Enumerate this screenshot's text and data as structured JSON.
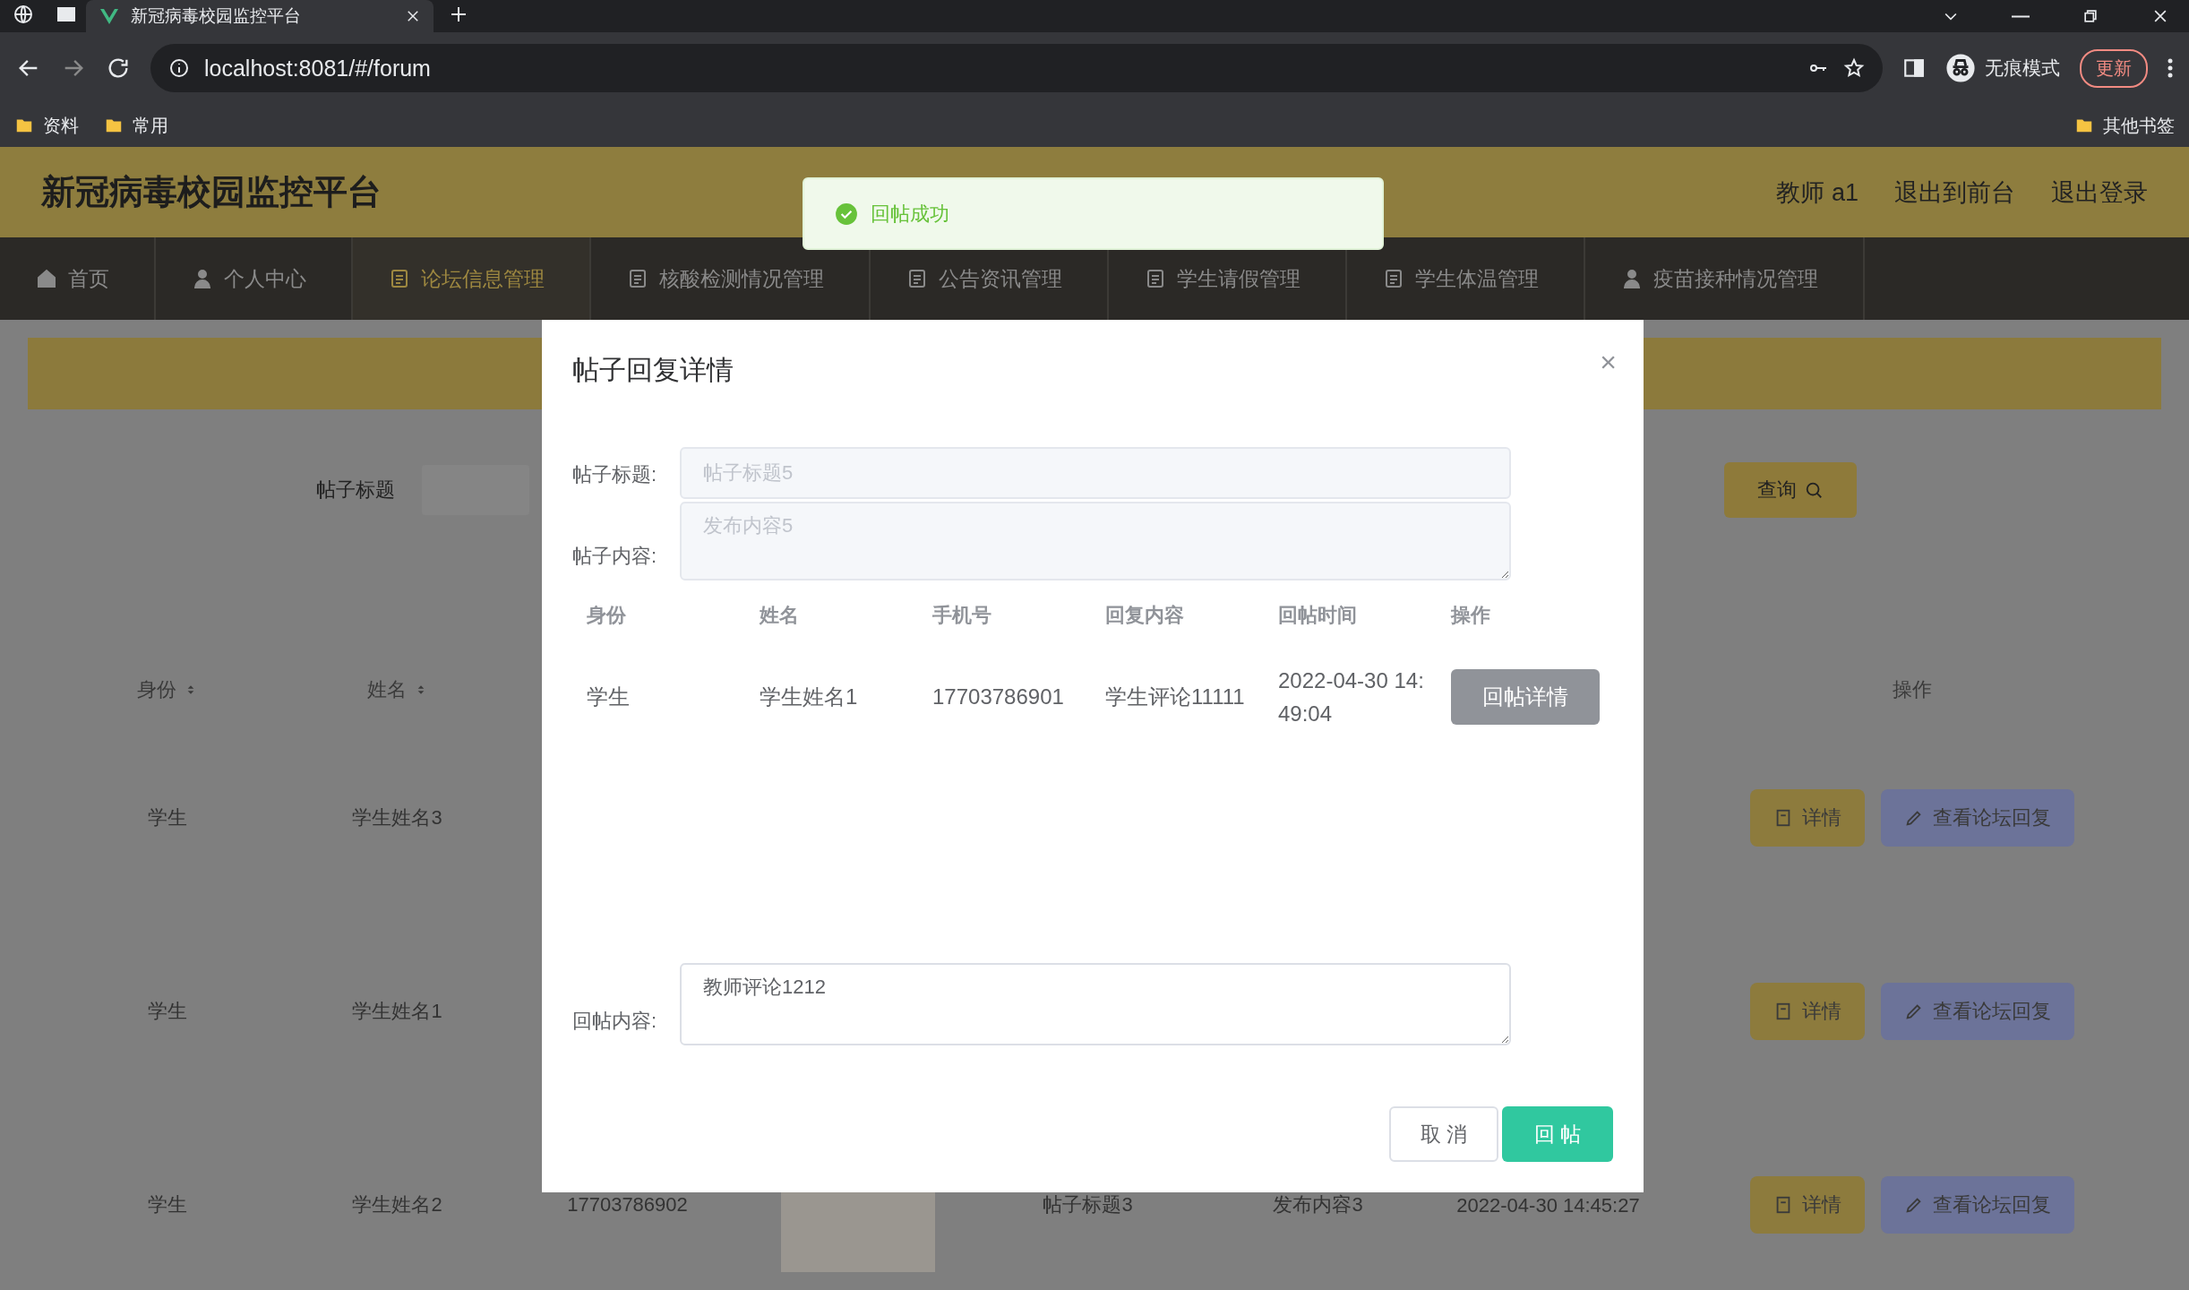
{
  "browser": {
    "tab_title": "新冠病毒校园监控平台",
    "address": "localhost:8081/#/forum",
    "incognito_label": "无痕模式",
    "update_button": "更新",
    "bookmarks": [
      "资料",
      "常用"
    ],
    "other_bookmarks": "其他书签"
  },
  "header": {
    "title": "新冠病毒校园监控平台",
    "user": "教师 a1",
    "links": [
      "退出到前台",
      "退出登录"
    ]
  },
  "nav": {
    "items": [
      {
        "label": "首页",
        "selected": false
      },
      {
        "label": "个人中心",
        "selected": false
      },
      {
        "label": "论坛信息管理",
        "selected": true
      },
      {
        "label": "核酸检测情况管理",
        "selected": false
      },
      {
        "label": "公告资讯管理",
        "selected": false
      },
      {
        "label": "学生请假管理",
        "selected": false
      },
      {
        "label": "学生体温管理",
        "selected": false
      },
      {
        "label": "疫苗接种情况管理",
        "selected": false
      }
    ]
  },
  "toast": {
    "message": "回帖成功"
  },
  "search": {
    "label": "帖子标题",
    "button": "查询"
  },
  "table": {
    "columns": [
      {
        "label": "身份",
        "sortable": true
      },
      {
        "label": "姓名",
        "sortable": true
      },
      {
        "label": "操作",
        "sortable": false
      }
    ],
    "rows": [
      {
        "identity": "学生",
        "name": "学生姓名3",
        "actions": [
          "详情",
          "查看论坛回复"
        ]
      },
      {
        "identity": "学生",
        "name": "学生姓名1",
        "actions": [
          "详情",
          "查看论坛回复"
        ]
      },
      {
        "identity": "学生",
        "name": "学生姓名2",
        "phone": "17703786902",
        "photo": true,
        "title": "帖子标题3",
        "content": "发布内容3",
        "time": "2022-04-30 14:45:27",
        "actions": [
          "详情",
          "查看论坛回复"
        ]
      }
    ]
  },
  "modal": {
    "title": "帖子回复详情",
    "close": "×",
    "post_title": {
      "label": "帖子标题:",
      "value": "帖子标题5",
      "disabled": true
    },
    "post_content": {
      "label": "帖子内容:",
      "value": "发布内容5",
      "disabled": true
    },
    "replies": {
      "columns": [
        "身份",
        "姓名",
        "手机号",
        "回复内容",
        "回帖时间",
        "操作"
      ],
      "rows": [
        {
          "identity": "学生",
          "name": "学生姓名1",
          "phone": "17703786901",
          "reply": "学生评论11111",
          "time": "2022-04-30 14:49:04",
          "action": "回帖详情"
        }
      ]
    },
    "reply": {
      "label": "回帖内容:",
      "value": "教师评论1212"
    },
    "buttons": {
      "cancel": "取 消",
      "submit": "回 帖"
    }
  }
}
